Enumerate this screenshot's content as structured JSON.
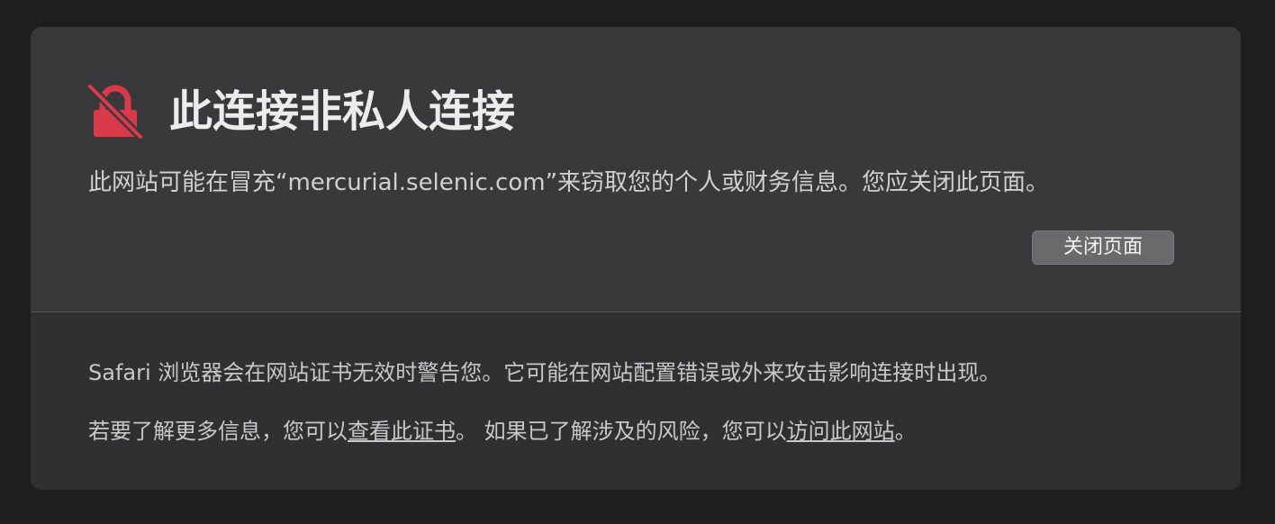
{
  "warning": {
    "icon": "lock-broken-icon",
    "icon_color": "#d93a4a",
    "title": "此连接非私人连接",
    "description": "此网站可能在冒充“mercurial.selenic.com”来窃取您的个人或财务信息。您应关闭此页面。",
    "close_button_label": "关闭页面"
  },
  "details": {
    "paragraph1": "Safari 浏览器会在网站证书无效时警告您。它可能在网站配置错误或外来攻击影响连接时出现。",
    "paragraph2_prefix": "若要了解更多信息，您可以",
    "view_certificate_link": "查看此证书",
    "paragraph2_middle": "。 如果已了解涉及的风险，您可以",
    "visit_site_link": "访问此网站",
    "paragraph2_suffix": "。"
  }
}
